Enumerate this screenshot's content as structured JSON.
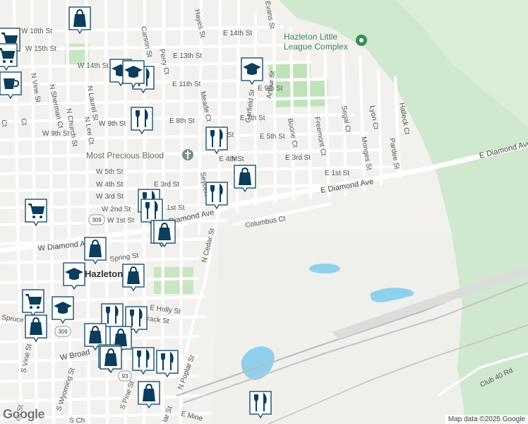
{
  "colors": {
    "background": "#f2f1ee",
    "street": "#ffffff",
    "street_casing": "#d6d6d6",
    "park": "#c8e6c2",
    "forest": "#cfe8cf",
    "water": "#8fd0ef",
    "rail": "#b8b8b8",
    "marker_fill": "#0b3d5c",
    "marker_bg": "#ffffff"
  },
  "streets": [
    {
      "name": "E 14th St"
    },
    {
      "name": "W 18th St"
    },
    {
      "name": "E 13th St"
    },
    {
      "name": "W 15th St"
    },
    {
      "name": "W 14th St"
    },
    {
      "name": "E 11th St"
    },
    {
      "name": "E 9th St"
    },
    {
      "name": "W 9th St"
    },
    {
      "name": "E 8th St"
    },
    {
      "name": "E 7th St"
    },
    {
      "name": "W 9th St"
    },
    {
      "name": "E 5th St"
    },
    {
      "name": "E 4th St"
    },
    {
      "name": "E 3rd St"
    },
    {
      "name": "W 5th St"
    },
    {
      "name": "W 4th St"
    },
    {
      "name": "E 3rd St"
    },
    {
      "name": "W 3rd St"
    },
    {
      "name": "E 1st St"
    },
    {
      "name": "W 2nd St"
    },
    {
      "name": "1st St"
    },
    {
      "name": "W 1st St"
    },
    {
      "name": "E Diamond Ave"
    },
    {
      "name": "E Diamond Ave"
    },
    {
      "name": "Diamond Ave"
    },
    {
      "name": "W Diamond Ave"
    },
    {
      "name": "Columbus Ct"
    },
    {
      "name": "Spring St"
    },
    {
      "name": "N Cedar St"
    },
    {
      "name": "E Holly St"
    },
    {
      "name": "Tamarack St"
    },
    {
      "name": "Spruce"
    },
    {
      "name": "W Broad"
    },
    {
      "name": "S Vine St"
    },
    {
      "name": "S Wyoming St"
    },
    {
      "name": "S Pine St"
    },
    {
      "name": "N Poplar St"
    },
    {
      "name": "E Mine"
    },
    {
      "name": "Club 40 Rd"
    },
    {
      "name": "N Church St"
    },
    {
      "name": "N Sherman Ct"
    },
    {
      "name": "N Laurel St"
    },
    {
      "name": "N Vine St"
    },
    {
      "name": "N Lee Ct"
    },
    {
      "name": "Carson St"
    },
    {
      "name": "Hayes St"
    },
    {
      "name": "Perry Ct"
    },
    {
      "name": "Meade Ct"
    },
    {
      "name": "Garfield St"
    },
    {
      "name": "Arthur St"
    },
    {
      "name": "Boone Ct"
    },
    {
      "name": "Freemont Ct"
    },
    {
      "name": "Segal Ct"
    },
    {
      "name": "Lyon Ct"
    },
    {
      "name": "Monges St"
    },
    {
      "name": "Halleck Ct"
    },
    {
      "name": "Pardee St"
    },
    {
      "name": "Evans St"
    },
    {
      "name": "Seybert"
    },
    {
      "name": "M"
    },
    {
      "name": "St"
    },
    {
      "name": "Ct"
    },
    {
      "name": "Ct"
    },
    {
      "name": "ch St"
    },
    {
      "name": "lar St"
    },
    {
      "name": "S Ch"
    }
  ],
  "pois": {
    "little_league": "Hazleton Little League Complex",
    "church": "Most Precious Blood",
    "city": "Hazleton"
  },
  "shields": [
    "309",
    "309",
    "93"
  ],
  "markers": [
    {
      "icon": "shopping-bag-icon"
    },
    {
      "icon": "shopping-cart-icon"
    },
    {
      "icon": "shopping-cart-icon"
    },
    {
      "icon": "cafe-icon"
    },
    {
      "icon": "school-icon"
    },
    {
      "icon": "restaurant-icon"
    },
    {
      "icon": "school-icon"
    },
    {
      "icon": "restaurant-icon"
    },
    {
      "icon": "school-icon"
    },
    {
      "icon": "restaurant-icon"
    },
    {
      "icon": "shopping-bag-icon"
    },
    {
      "icon": "restaurant-icon"
    },
    {
      "icon": "restaurant-icon"
    },
    {
      "icon": "restaurant-icon"
    },
    {
      "icon": "restaurant-icon"
    },
    {
      "icon": "shopping-cart-icon"
    },
    {
      "icon": "shopping-bag-icon"
    },
    {
      "icon": "shopping-bag-icon"
    },
    {
      "icon": "school-icon"
    },
    {
      "icon": "shopping-bag-icon"
    },
    {
      "icon": "shopping-cart-icon"
    },
    {
      "icon": "school-icon"
    },
    {
      "icon": "shopping-bag-icon"
    },
    {
      "icon": "restaurant-icon"
    },
    {
      "icon": "restaurant-icon"
    },
    {
      "icon": "shopping-bag-icon"
    },
    {
      "icon": "shopping-bag-icon"
    },
    {
      "icon": "shopping-bag-icon"
    },
    {
      "icon": "restaurant-icon"
    },
    {
      "icon": "restaurant-icon"
    },
    {
      "icon": "shopping-bag-icon"
    },
    {
      "icon": "shopping-bag-icon"
    },
    {
      "icon": "restaurant-icon"
    }
  ],
  "footer": {
    "logo": "Google",
    "attribution": "Map data ©2025 Google"
  }
}
